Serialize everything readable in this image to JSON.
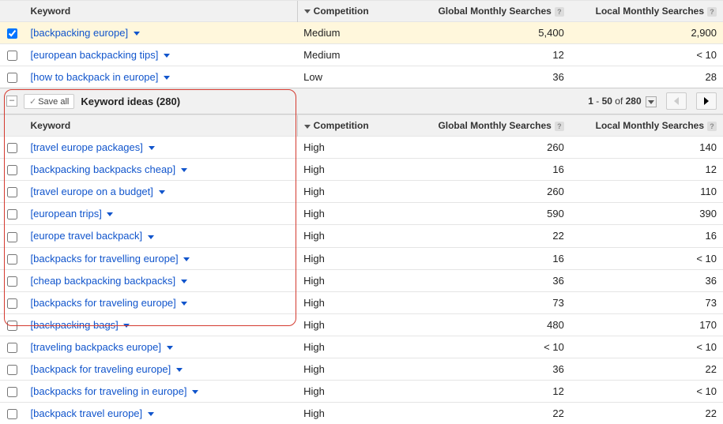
{
  "headers": {
    "keyword": "Keyword",
    "competition": "Competition",
    "global": "Global Monthly Searches",
    "local": "Local Monthly Searches"
  },
  "top_rows": [
    {
      "checked": true,
      "keyword": "[backpacking europe]",
      "competition": "Medium",
      "global": "5,400",
      "local": "2,900",
      "highlight": true
    },
    {
      "checked": false,
      "keyword": "[european backpacking tips]",
      "competition": "Medium",
      "global": "12",
      "local": "< 10"
    },
    {
      "checked": false,
      "keyword": "[how to backpack in europe]",
      "competition": "Low",
      "global": "36",
      "local": "28"
    }
  ],
  "section": {
    "save_all": "Save all",
    "title": "Keyword ideas (280)",
    "page_from": "1",
    "page_to": "50",
    "of_label": "of",
    "total": "280"
  },
  "idea_rows": [
    {
      "keyword": "[travel europe packages]",
      "competition": "High",
      "global": "260",
      "local": "140"
    },
    {
      "keyword": "[backpacking backpacks cheap]",
      "competition": "High",
      "global": "16",
      "local": "12"
    },
    {
      "keyword": "[travel europe on a budget]",
      "competition": "High",
      "global": "260",
      "local": "110"
    },
    {
      "keyword": "[european trips]",
      "competition": "High",
      "global": "590",
      "local": "390"
    },
    {
      "keyword": "[europe travel backpack]",
      "competition": "High",
      "global": "22",
      "local": "16"
    },
    {
      "keyword": "[backpacks for travelling europe]",
      "competition": "High",
      "global": "16",
      "local": "< 10"
    },
    {
      "keyword": "[cheap backpacking backpacks]",
      "competition": "High",
      "global": "36",
      "local": "36"
    },
    {
      "keyword": "[backpacks for traveling europe]",
      "competition": "High",
      "global": "73",
      "local": "73"
    },
    {
      "keyword": "[backpacking bags]",
      "competition": "High",
      "global": "480",
      "local": "170"
    },
    {
      "keyword": "[traveling backpacks europe]",
      "competition": "High",
      "global": "< 10",
      "local": "< 10"
    },
    {
      "keyword": "[backpack for traveling europe]",
      "competition": "High",
      "global": "36",
      "local": "22"
    },
    {
      "keyword": "[backpacks for traveling in europe]",
      "competition": "High",
      "global": "12",
      "local": "< 10"
    },
    {
      "keyword": "[backpack travel europe]",
      "competition": "High",
      "global": "22",
      "local": "22"
    }
  ]
}
